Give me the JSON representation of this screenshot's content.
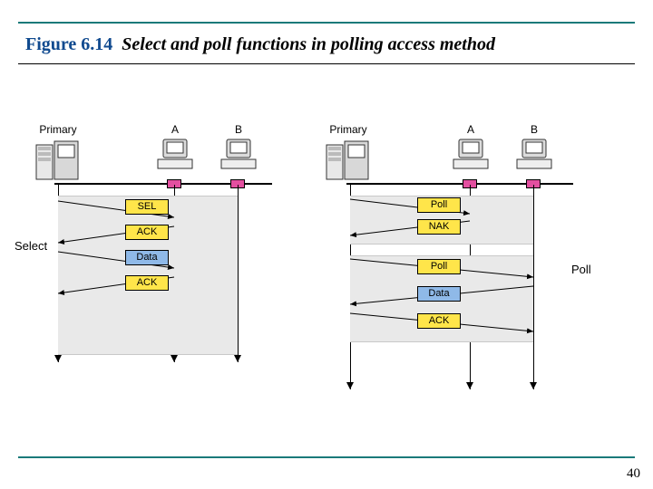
{
  "figure_number": "Figure 6.14",
  "caption": "Select and poll functions in polling access method",
  "page_number": "40",
  "left": {
    "primary_label": "Primary",
    "station_a": "A",
    "station_b": "B",
    "side_label": "Select",
    "messages": [
      "SEL",
      "ACK",
      "Data",
      "ACK"
    ],
    "message_styles": [
      "y",
      "y",
      "b",
      "y"
    ]
  },
  "right": {
    "primary_label": "Primary",
    "station_a": "A",
    "station_b": "B",
    "side_label": "Poll",
    "messages": [
      "Poll",
      "NAK",
      "Poll",
      "Data",
      "ACK"
    ],
    "message_styles": [
      "y",
      "y",
      "y",
      "b",
      "y"
    ]
  }
}
